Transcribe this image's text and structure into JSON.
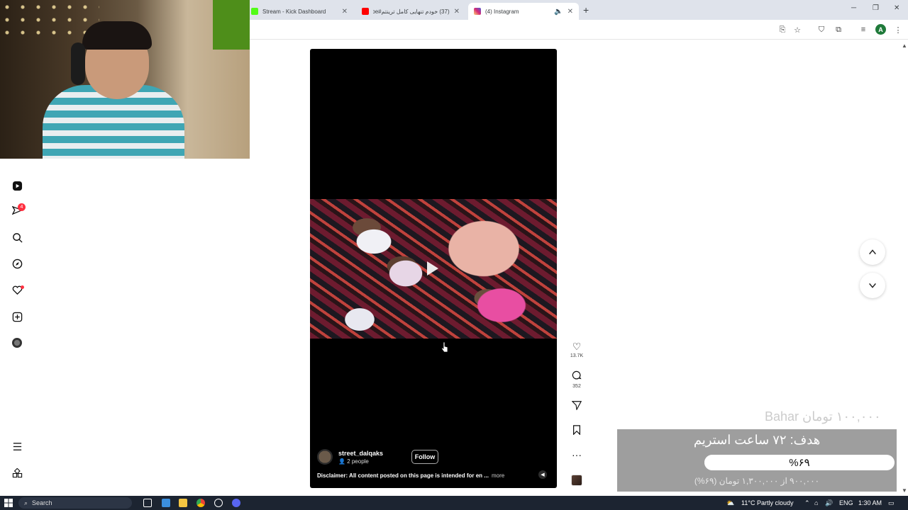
{
  "browser": {
    "tabs": [
      {
        "title": "Stream - Kick Dashboard",
        "favicon_color": "#53fc18",
        "active": false
      },
      {
        "title": "(37) خودم تنهایی کامل ترینتم#be.",
        "favicon_color": "#ff0000",
        "active": false
      },
      {
        "title": "(4) Instagram",
        "favicon_color": "#e1306c",
        "active": true
      }
    ],
    "new_tab_label": "+",
    "profile_letter": "A"
  },
  "sidebar": {
    "notification_count": "4",
    "items": [
      "reels-icon",
      "messages-icon",
      "search-icon",
      "explore-icon",
      "notifications-icon",
      "create-icon",
      "profile-icon",
      "more-icon",
      "threads-icon"
    ]
  },
  "reel": {
    "author": "street_dalqaks",
    "audience": "2 people",
    "follow_label": "Follow",
    "caption": "Disclaimer: All content posted on this page is intended for en ...",
    "more_label": "more"
  },
  "actions": {
    "likes": "13.7K",
    "comments": "352"
  },
  "goal": {
    "watermark": "۱۰۰,۰۰۰ تومان Bahar",
    "title": "هدف: ۷۲ ساعت استریم",
    "percent_label": "%۶۹",
    "percent": 69,
    "amount": "۹۰۰,۰۰۰ از ۱,۳۰۰,۰۰۰ تومان (۶۹%)"
  },
  "taskbar": {
    "search_label": "Search",
    "weather": "11°C  Partly cloudy",
    "language": "ENG",
    "time": "1:30 AM"
  }
}
